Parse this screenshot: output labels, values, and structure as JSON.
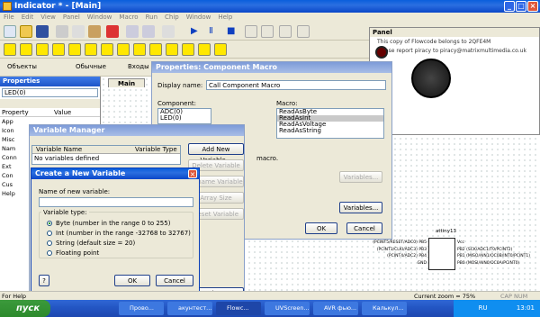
{
  "app": {
    "title": "Indicator * - [Main]"
  },
  "menu": [
    "File",
    "Edit",
    "View",
    "Panel",
    "Window",
    "Macro",
    "Run",
    "Chip",
    "Window",
    "Help"
  ],
  "toolbar3": {
    "btn1": "Объекты",
    "btn2": "Обычные",
    "btn3": "Входы"
  },
  "properties": {
    "title": "Properties",
    "selected": "LED(0)",
    "col_property": "Property",
    "col_value": "Value",
    "rows": [
      "App",
      "Icon",
      "Misc",
      "Nam",
      "Conn",
      "Ext",
      "Con",
      "Cus",
      "Help"
    ],
    "help_label": "For Help"
  },
  "tab": {
    "label": "Main"
  },
  "panel": {
    "title": "Panel",
    "line1": "This copy of Flowcode belongs to 2QFE4M",
    "line2": "Please report piracy to piracy@matrixmultimedia.co.uk"
  },
  "macro_dialog": {
    "title": "Properties: Component Macro",
    "display_name_label": "Display name:",
    "display_name_value": "Call Component Macro",
    "component_label": "Component:",
    "components": [
      "ADC(0)",
      "LED(0)"
    ],
    "macro_label": "Macro:",
    "macros": [
      "ReadAsByte",
      "ReadAsInt",
      "ReadAsVoltage",
      "ReadAsString"
    ],
    "selected_macro": "ReadAsInt",
    "partial_text": "macro.",
    "variables_btn": "Variables...",
    "variables_btn2": "Variables...",
    "ok": "OK",
    "cancel": "Cancel"
  },
  "var_manager": {
    "title": "Variable Manager",
    "col_name": "Variable Name",
    "col_type": "Variable Type",
    "empty_text": "No variables defined",
    "add": "Add New Variable...",
    "delete": "Delete Variable",
    "rename": "Rename Variable",
    "array": "Array Size",
    "reset": "Reset Variable",
    "close": "Close"
  },
  "new_var": {
    "title": "Create a New Variable",
    "name_label": "Name of new variable:",
    "name_value": "",
    "type_label": "Variable type:",
    "types": [
      "Byte (number in the range 0 to 255)",
      "Int (number in the range -32768 to 32767)",
      "String (default size = 20)",
      "Floating point"
    ],
    "selected_index": 0,
    "help": "?",
    "ok": "OK",
    "cancel": "Cancel"
  },
  "chip": {
    "name": "attiny13",
    "left_pins": [
      "(PCINT5/RESET/ADC0) PB5",
      "(PCINT3/CLKI/ADC3) PB3",
      "(PCINT4/ADC2) PB4",
      "GND"
    ],
    "right_pins": [
      "Vcc",
      "PB2 (SCK/ADC1/T0/PCINT2)",
      "PB1 (MISO/AIN1/OC0B/INT0/PCINT1)",
      "PB0 (MOSI/AIN0/OC0A/PCINT0)"
    ]
  },
  "status": {
    "zoom": "Current zoom = 75%",
    "caps": "CAP  NUM  SCRL"
  },
  "taskbar": {
    "start": "пуск",
    "tasks": [
      "Прово...",
      "акунтест...",
      "Flowc...",
      "UVScreen...",
      "AVR фью...",
      "Калькул..."
    ],
    "lang": "RU",
    "clock": "13:01"
  },
  "colors": {
    "xp_blue": "#0a5fdc",
    "start_green": "#2c8a2c",
    "selection": "#c9c9c9"
  }
}
